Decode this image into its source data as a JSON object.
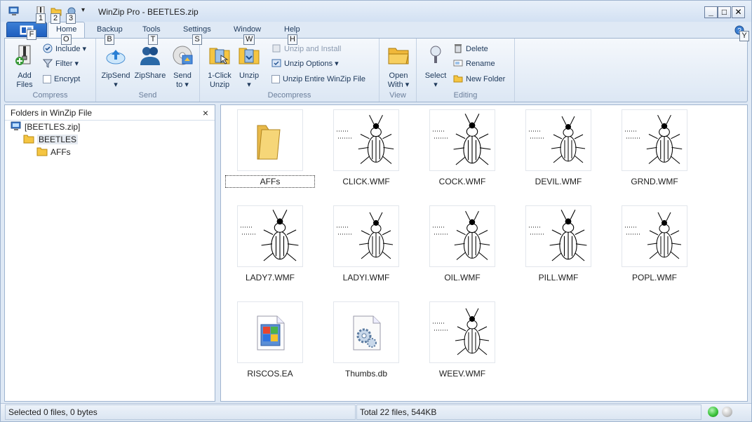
{
  "window": {
    "title": "WinZip Pro - BEETLES.zip",
    "minimize": "_",
    "maximize": "□",
    "close": "✕"
  },
  "keytips": {
    "qa1": "1",
    "qa2": "2",
    "qa3": "3",
    "file": "F",
    "home": "O",
    "backup": "B",
    "tools": "T",
    "settings": "S",
    "window": "W",
    "help": "H",
    "help_btn": "Y"
  },
  "tabs": [
    "Home",
    "Backup",
    "Tools",
    "Settings",
    "Window",
    "Help"
  ],
  "ribbon": {
    "compress": {
      "label": "Compress",
      "add_files": [
        "Add",
        "Files"
      ],
      "include": "Include",
      "filter": "Filter",
      "encrypt": "Encrypt"
    },
    "send": {
      "label": "Send",
      "zipsend": "ZipSend",
      "zipshare": "ZipShare",
      "send_to": [
        "Send",
        "to"
      ]
    },
    "decompress": {
      "label": "Decompress",
      "one_click": [
        "1-Click",
        "Unzip"
      ],
      "unzip": "Unzip",
      "unzip_install": "Unzip and Install",
      "unzip_options": "Unzip Options",
      "unzip_entire": "Unzip Entire WinZip File"
    },
    "view": {
      "label": "View",
      "open_with": [
        "Open",
        "With"
      ]
    },
    "editing": {
      "label": "Editing",
      "select": "Select",
      "delete": "Delete",
      "rename": "Rename",
      "new_folder": "New Folder"
    }
  },
  "left_pane": {
    "title": "Folders in WinZip File",
    "close": "×",
    "tree": [
      "[BEETLES.zip]",
      "BEETLES",
      "AFFs"
    ]
  },
  "files": [
    {
      "name": "AFFs",
      "kind": "folder"
    },
    {
      "name": "CLICK.WMF",
      "kind": "beetle"
    },
    {
      "name": "COCK.WMF",
      "kind": "beetle"
    },
    {
      "name": "DEVIL.WMF",
      "kind": "beetle"
    },
    {
      "name": "GRND.WMF",
      "kind": "beetle"
    },
    {
      "name": "LADY7.WMF",
      "kind": "beetle"
    },
    {
      "name": "LADYI.WMF",
      "kind": "beetle"
    },
    {
      "name": "OIL.WMF",
      "kind": "beetle"
    },
    {
      "name": "PILL.WMF",
      "kind": "beetle"
    },
    {
      "name": "POPL.WMF",
      "kind": "beetle"
    },
    {
      "name": "RISCOS.EA",
      "kind": "windows-file"
    },
    {
      "name": "Thumbs.db",
      "kind": "system-file"
    },
    {
      "name": "WEEV.WMF",
      "kind": "beetle"
    }
  ],
  "status": {
    "selected": "Selected 0 files, 0 bytes",
    "total": "Total 22 files, 544KB"
  },
  "colors": {
    "accent": "#1f5fbf",
    "led_on": "#3cc43c",
    "led_off": "#c9c9c9"
  }
}
